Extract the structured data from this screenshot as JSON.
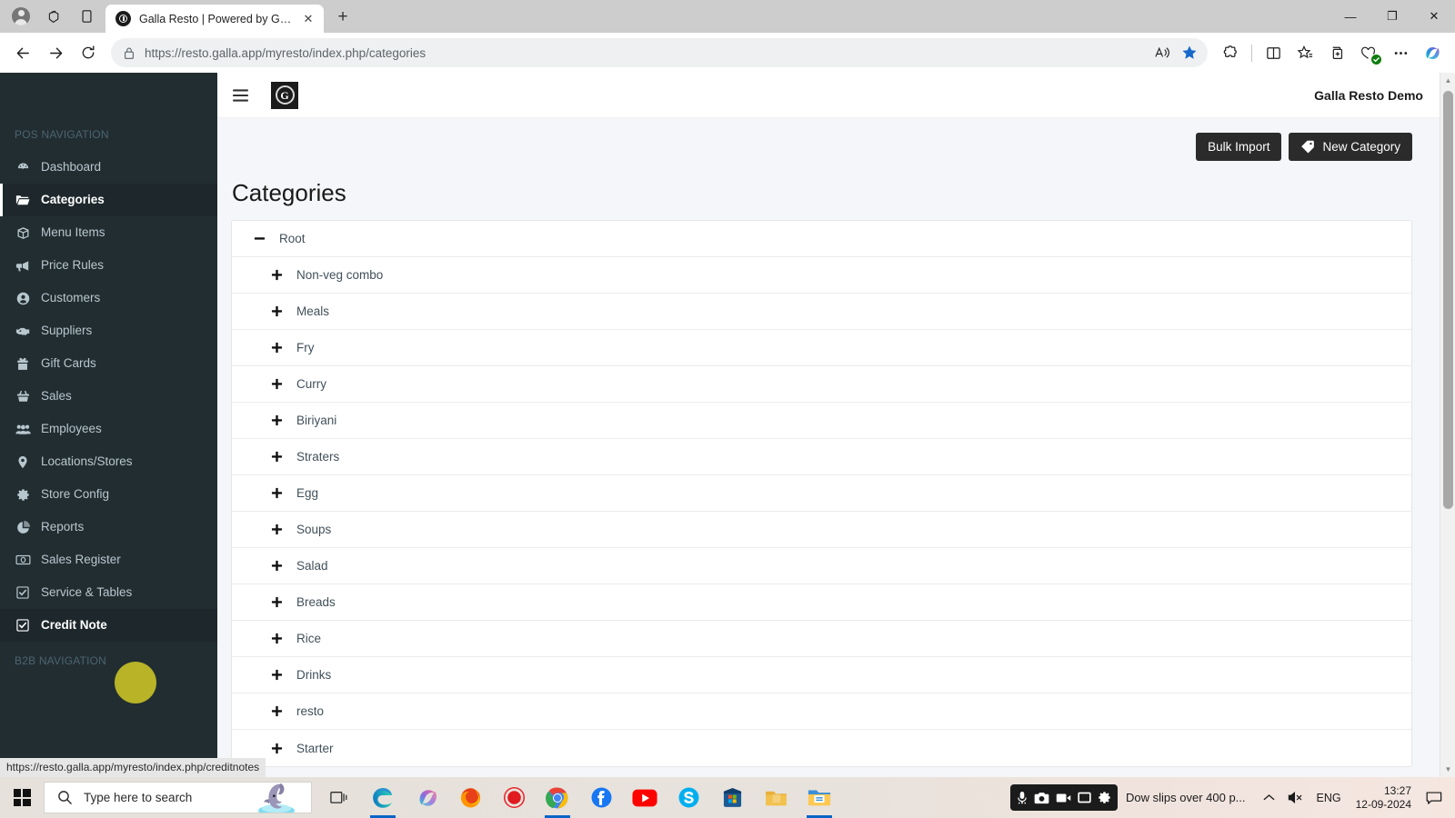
{
  "browser": {
    "tab": {
      "title": "Galla Resto | Powered by Galla",
      "favicon": "G",
      "close_label": "✕"
    },
    "new_tab_label": "+",
    "address": {
      "url": "https://resto.galla.app/myresto/index.php/categories",
      "lock_icon": "lock-icon",
      "read_aloud_icon": "read-aloud-icon",
      "favorite_icon": "star-filled-icon"
    },
    "nav": {
      "back": "←",
      "forward": "→",
      "refresh": "⟳"
    },
    "window_controls": {
      "minimize": "—",
      "maximize": "❐",
      "close": "✕"
    },
    "toolbar_icons": [
      "extensions-icon",
      "split-screen-icon",
      "favorites-icon",
      "collections-icon",
      "browser-essentials-icon",
      "settings-more-icon",
      "copilot-icon"
    ],
    "status_link": "https://resto.galla.app/myresto/index.php/creditnotes"
  },
  "sidebar": {
    "sections": [
      {
        "header": "POS NAVIGATION",
        "items": [
          {
            "label": "Dashboard",
            "icon": "dashboard-icon",
            "state": "normal"
          },
          {
            "label": "Categories",
            "icon": "folder-open-icon",
            "state": "active"
          },
          {
            "label": "Menu Items",
            "icon": "cube-icon",
            "state": "normal"
          },
          {
            "label": "Price Rules",
            "icon": "bullhorn-icon",
            "state": "normal"
          },
          {
            "label": "Customers",
            "icon": "user-circle-icon",
            "state": "normal"
          },
          {
            "label": "Suppliers",
            "icon": "handshake-icon",
            "state": "normal"
          },
          {
            "label": "Gift Cards",
            "icon": "gift-icon",
            "state": "normal"
          },
          {
            "label": "Sales",
            "icon": "basket-icon",
            "state": "normal"
          },
          {
            "label": "Employees",
            "icon": "users-icon",
            "state": "normal"
          },
          {
            "label": "Locations/Stores",
            "icon": "map-pin-icon",
            "state": "normal"
          },
          {
            "label": "Store Config",
            "icon": "gear-icon",
            "state": "normal"
          },
          {
            "label": "Reports",
            "icon": "pie-chart-icon",
            "state": "normal"
          },
          {
            "label": "Sales Register",
            "icon": "cash-register-icon",
            "state": "normal"
          },
          {
            "label": "Service & Tables",
            "icon": "check-square-icon",
            "state": "normal"
          },
          {
            "label": "Credit Note",
            "icon": "check-square-icon",
            "state": "hovered"
          }
        ]
      },
      {
        "header": "B2B NAVIGATION",
        "items": []
      }
    ]
  },
  "app": {
    "hamburger_icon": "hamburger-menu-icon",
    "brand_logo_letter": "G",
    "user_label": "Galla Resto Demo",
    "actions": {
      "bulk_import": "Bulk Import",
      "new_category": "New Category",
      "new_category_icon": "tag-icon"
    },
    "page_title": "Categories",
    "tree": [
      {
        "label": "Root",
        "toggle": "minus",
        "indent": 0
      },
      {
        "label": "Non-veg combo",
        "toggle": "plus",
        "indent": 1
      },
      {
        "label": "Meals",
        "toggle": "plus",
        "indent": 1
      },
      {
        "label": "Fry",
        "toggle": "plus",
        "indent": 1
      },
      {
        "label": "Curry",
        "toggle": "plus",
        "indent": 1
      },
      {
        "label": "Biriyani",
        "toggle": "plus",
        "indent": 1
      },
      {
        "label": "Straters",
        "toggle": "plus",
        "indent": 1
      },
      {
        "label": "Egg",
        "toggle": "plus",
        "indent": 1
      },
      {
        "label": "Soups",
        "toggle": "plus",
        "indent": 1
      },
      {
        "label": "Salad",
        "toggle": "plus",
        "indent": 1
      },
      {
        "label": "Breads",
        "toggle": "plus",
        "indent": 1
      },
      {
        "label": "Rice",
        "toggle": "plus",
        "indent": 1
      },
      {
        "label": "Drinks",
        "toggle": "plus",
        "indent": 1
      },
      {
        "label": "resto",
        "toggle": "plus",
        "indent": 1
      },
      {
        "label": "Starter",
        "toggle": "plus",
        "indent": 1
      }
    ]
  },
  "taskbar": {
    "start_icon": "windows-start-icon",
    "search_placeholder": "Type here to search",
    "task_view_icon": "task-view-icon",
    "apps": [
      "edge-icon",
      "copilot-icon",
      "firefox-icon",
      "record-icon",
      "chrome-icon",
      "facebook-icon",
      "youtube-icon",
      "skype-icon",
      "microsoft-store-icon",
      "folder-yellow-icon",
      "file-explorer-icon"
    ],
    "recorder": [
      "mic-icon",
      "camera-icon",
      "video-icon",
      "screen-icon",
      "gear-icon"
    ],
    "news": "Dow slips over 400 p...",
    "tray": {
      "chevron": "show-hidden-icons-icon",
      "volume": "volume-muted-icon",
      "language": "ENG",
      "time": "13:27",
      "date": "12-09-2024",
      "notifications": "notification-icon"
    }
  },
  "colors": {
    "sidebar_bg": "#222d32",
    "sidebar_active_bg": "#1e282c",
    "sidebar_text": "#b8c7ce",
    "content_bg": "#f4f6f9",
    "button_dark": "#2b2b2b",
    "cursor_blob": "#b8b327"
  }
}
